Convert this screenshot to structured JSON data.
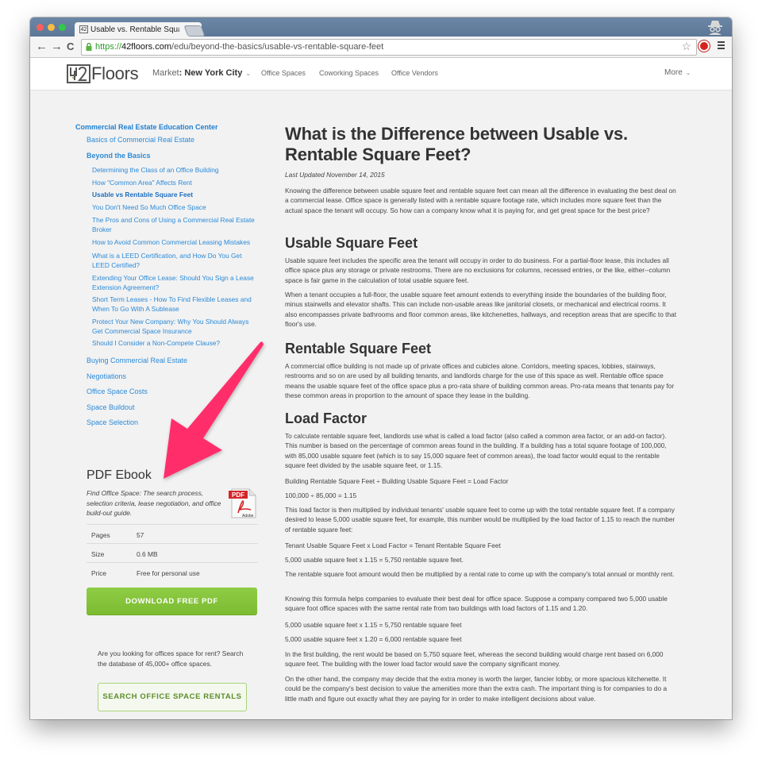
{
  "browser": {
    "tab_title": "Usable vs. Rentable Square Feet",
    "tab_favicon_text": "42",
    "url_scheme": "https://",
    "url_host": "42floors.com",
    "url_path": "/edu/beyond-the-basics/usable-vs-rentable-square-feet",
    "icons": {
      "back": "←",
      "forward": "→",
      "reload": "C",
      "bookmark_star": "☆",
      "close_tab": "×"
    }
  },
  "site_header": {
    "logo_text": "Floors",
    "market_label": "Market",
    "market_value": "New York City",
    "nav": [
      "Office Spaces",
      "Coworking Spaces",
      "Office Vendors"
    ],
    "more_label": "More"
  },
  "sidebar": {
    "root": "Commercial Real Estate Education Center",
    "basics": "Basics of Commercial Real Estate",
    "beyond": "Beyond the Basics",
    "beyond_items": [
      "Determining the Class of an Office Building",
      "How \"Common Area\" Affects Rent",
      "Usable vs Rentable Square Feet",
      "You Don't Need So Much Office Space",
      "The Pros and Cons of Using a Commercial Real Estate Broker",
      "How to Avoid Common Commercial Leasing Mistakes",
      "What is a LEED Certification, and How Do You Get LEED Certified?",
      "Extending Your Office Lease: Should You Sign a Lease Extension Agreement?",
      "Short Term Leases - How To Find Flexible Leases and When To Go With A Sublease",
      "Protect Your New Company: Why You Should Always Get Commercial Space Insurance",
      "Should I Consider a Non-Compete Clause?"
    ],
    "active_item": "Usable vs Rentable Square Feet",
    "sections": [
      "Buying Commercial Real Estate",
      "Negotiations",
      "Office Space Costs",
      "Space Buildout",
      "Space Selection"
    ]
  },
  "ebook": {
    "title": "PDF Ebook",
    "description": "Find Office Space: The search process, selection criteria, lease negotiation, and office build-out guide.",
    "icon_label": "PDF",
    "icon_brand": "Adobe",
    "rows": [
      {
        "key": "Pages",
        "value": "57"
      },
      {
        "key": "Size",
        "value": "0.6 MB"
      },
      {
        "key": "Price",
        "value": "Free for personal use"
      }
    ],
    "download_label": "DOWNLOAD FREE PDF"
  },
  "promo": {
    "text": "Are you looking for offices space for rent? Search the database of 45,000+ office spaces.",
    "button_label": "SEARCH OFFICE SPACE RENTALS"
  },
  "article": {
    "title": "What is the Difference between Usable vs. Rentable Square Feet?",
    "last_updated": "Last Updated November 14, 2015",
    "intro": "Knowing the difference between usable square feet and rentable square feet can mean all the difference in evaluating the best deal on a commercial lease. Office space is generally listed with a rentable square footage rate, which includes more square feet than the actual space the tenant will occupy. So how can a company know what it is paying for, and get great space for the best price?",
    "usable_heading": "Usable Square Feet",
    "usable_p1": "Usable square feet includes the specific area the tenant will occupy in order to do business. For a partial-floor lease, this includes all office space plus any storage or private restrooms. There are no exclusions for columns, recessed entries, or the like, either--column space is fair game in the calculation of total usable square feet.",
    "usable_p2": "When a tenant occupies a full-floor, the usable square feet amount extends to everything inside the boundaries of the building floor, minus stairwells and elevator shafts. This can include non-usable areas like janitorial closets, or mechanical and electrical rooms. It also encompasses private bathrooms and floor common areas, like kitchenettes, hallways, and reception areas that are specific to that floor's use.",
    "rentable_heading": "Rentable Square Feet",
    "rentable_p1": "A commercial office building is not made up of private offices and cubicles alone. Corridors, meeting spaces, lobbies, stairways, restrooms and so on are used by all building tenants, and landlords charge for the use of this space as well. Rentable office space means the usable square feet of the office space plus a pro-rata share of building common areas. Pro-rata means that tenants pay for these common areas in proportion to the amount of space they lease in the building.",
    "load_heading": "Load Factor",
    "load_p1": "To calculate rentable square feet, landlords use what is called a load factor (also called a common area factor, or an add-on factor). This number is based on the percentage of common areas found in the building. If a building has a total square footage of 100,000, with 85,000 usable square feet (which is to say 15,000 square feet of common areas), the load factor would equal to the rentable square feet divided by the usable square feet, or 1.15.",
    "formula1": "Building Rentable Square Feet ÷ Building Usable Square Feet = Load Factor",
    "example1": "100,000 ÷ 85,000 = 1.15",
    "load_p2": "This load factor is then multiplied by individual tenants' usable square feet to come up with the total rentable square feet. If a company desired to lease 5,000 usable square feet, for example, this number would be multiplied by the load factor of 1.15 to reach the number of rentable square feet:",
    "formula2": "Tenant Usable Square Feet x Load Factor = Tenant Rentable Square Feet",
    "example2": "5,000 usable square feet x 1.15 = 5,750 rentable square feet.",
    "load_p3": "The rentable square foot amount would then be multiplied by a rental rate to come up with the company's total annual or monthly rent.",
    "load_p4": "Knowing this formula helps companies to evaluate their best deal for office space. Suppose a company compared two 5,000 usable square foot office spaces with the same rental rate from two buildings with load factors of 1.15 and 1.20.",
    "example3": "5,000 usable square feet x 1.15 = 5,750 rentable square feet",
    "example4": "5,000 usable square feet x 1.20 = 6,000 rentable square feet",
    "load_p5": "In the first building, the rent would be based on 5,750 square feet, whereas the second building would charge rent based on 6,000 square feet. The building with the lower load factor would save the company significant money.",
    "load_p6": "On the other hand, the company may decide that the extra money is worth the larger, fancier lobby, or more spacious kitchenette. It could be the company's best decision to value the amenities more than the extra cash. The important thing is for companies to do a little math and figure out exactly what they are paying for in order to make intelligent decisions about value."
  },
  "colors": {
    "link": "#2b8ad8",
    "download_green": "#7bbb31",
    "annotation_arrow": "#ff2d6a",
    "page_bg": "#f2f2f2"
  }
}
